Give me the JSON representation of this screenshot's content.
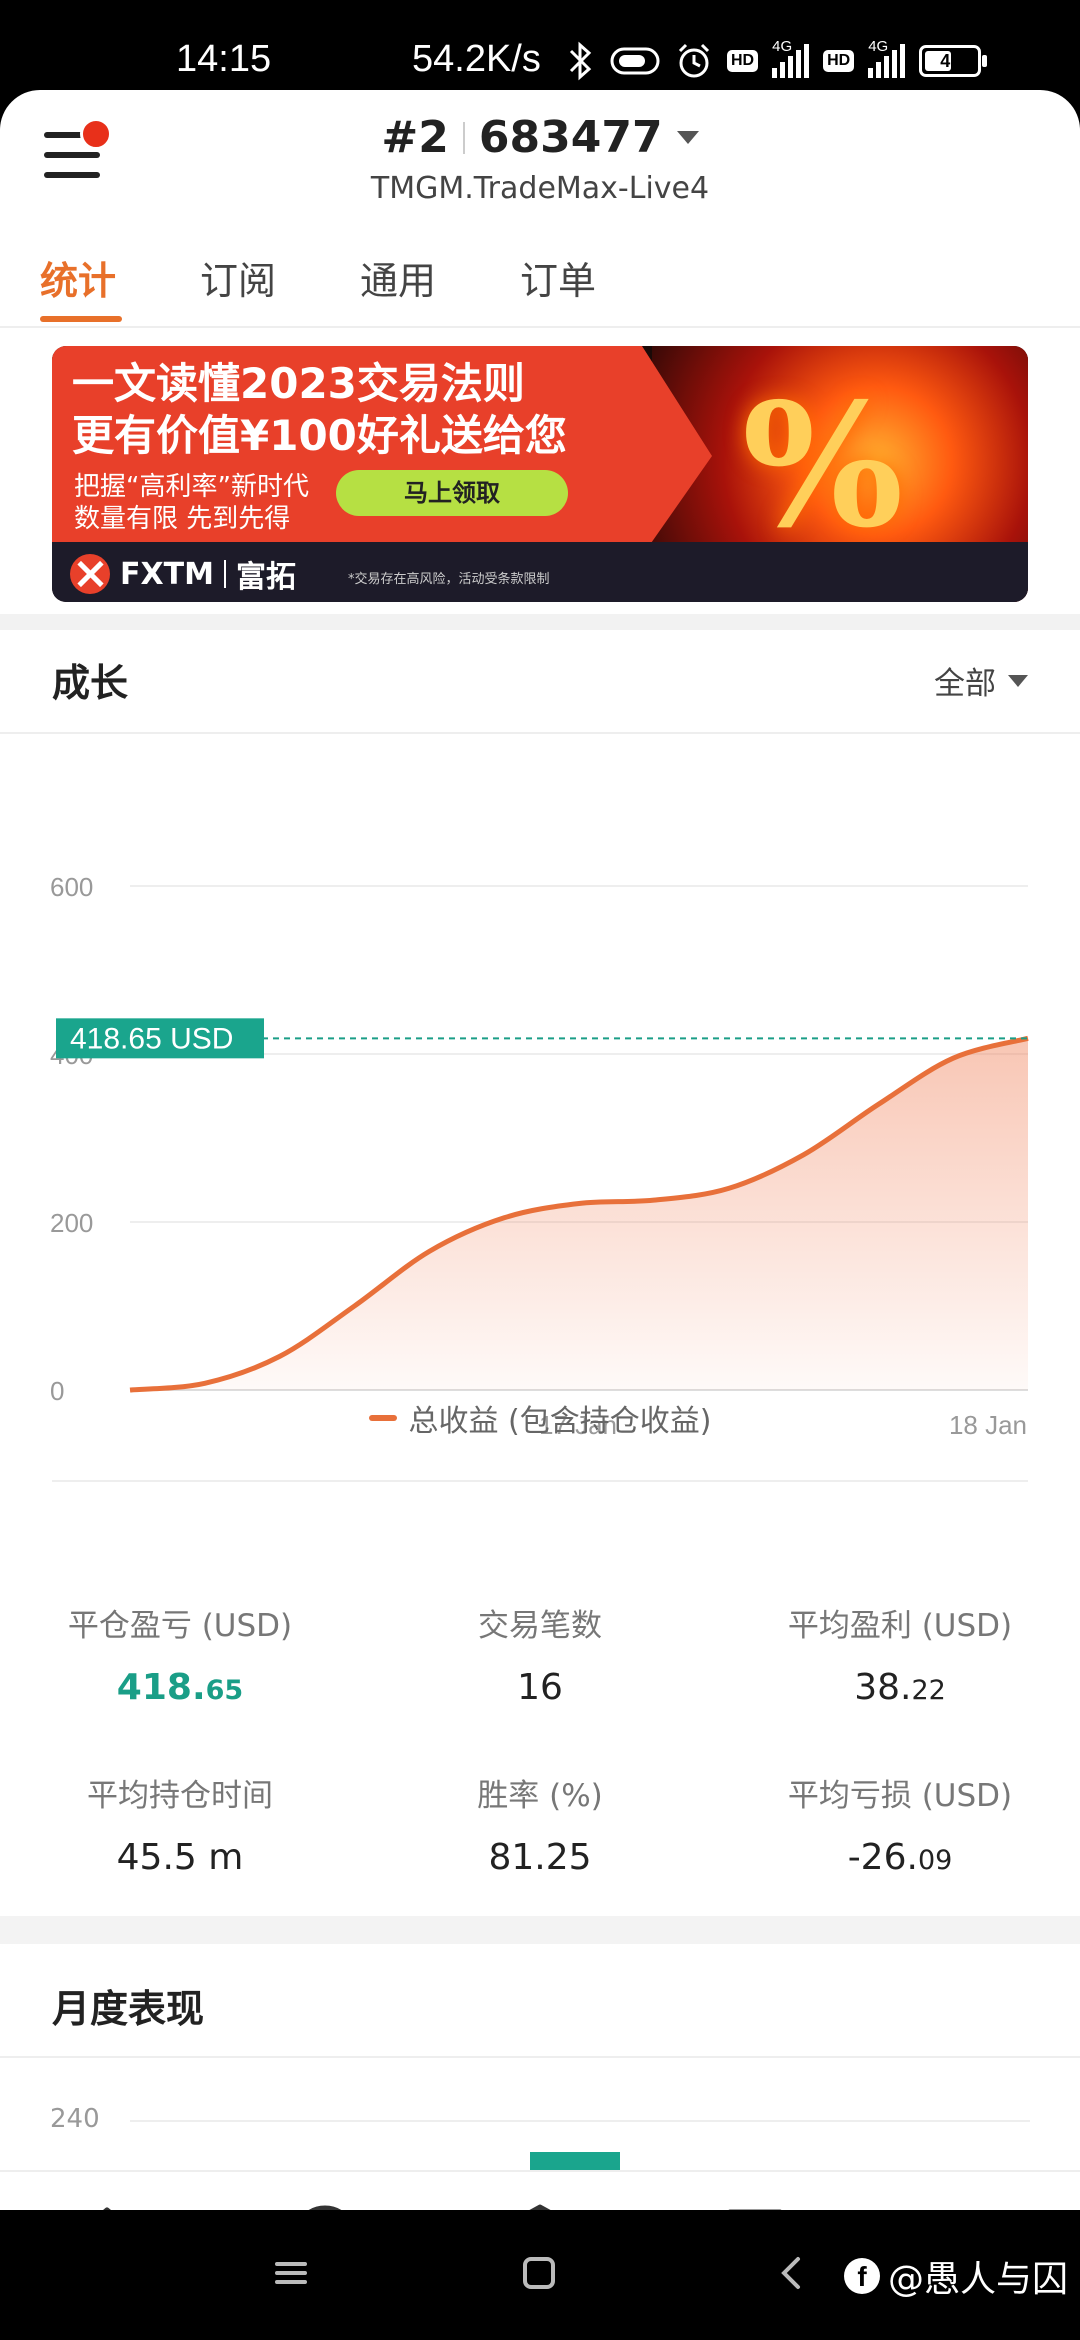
{
  "status_bar": {
    "time": "14:15",
    "net_speed": "54.2K/s",
    "hd_label": "HD",
    "network_label": "4G",
    "battery": "47"
  },
  "header": {
    "account_number": "#2",
    "account_id": "683477",
    "server": "TMGM.TradeMax-Live4"
  },
  "tabs": [
    {
      "label": "统计",
      "active": true
    },
    {
      "label": "订阅",
      "active": false
    },
    {
      "label": "通用",
      "active": false
    },
    {
      "label": "订单",
      "active": false
    }
  ],
  "banner": {
    "headline1": "一文读懂2023交易法则",
    "headline2": "更有价值¥100好礼送给您",
    "sub1": "把握“高利率”新时代",
    "sub2": "数量有限 先到先得",
    "cta": "马上领取",
    "brand": "FXTM",
    "brand_cn": "富拓",
    "disclaimer": "*交易存在高风险，活动受条款限制",
    "graphic_text": "%"
  },
  "growth": {
    "title": "成长",
    "filter": "全部"
  },
  "chart_data": {
    "type": "area",
    "y_ticks": [
      "600",
      "400",
      "200",
      "0"
    ],
    "x_ticks": [
      "17 Jan",
      "18 Jan"
    ],
    "ylim": [
      0,
      600
    ],
    "current_value_label": "418.65 USD",
    "current_value": 418.65,
    "series": [
      {
        "name": "总收益 (包含持仓收益)",
        "color": "#e8703a",
        "values": [
          0,
          8,
          40,
          100,
          165,
          205,
          222,
          226,
          240,
          280,
          340,
          395,
          418.65
        ]
      }
    ]
  },
  "stats": [
    {
      "label": "平仓盈亏 (USD)",
      "value": "418.",
      "decimals": "65",
      "green": true
    },
    {
      "label": "交易笔数",
      "value": "16",
      "decimals": "",
      "green": false
    },
    {
      "label": "平均盈利 (USD)",
      "value": "38.",
      "decimals": "22",
      "green": false
    },
    {
      "label": "平均持仓时间",
      "value": "45.5 m",
      "decimals": "",
      "green": false
    },
    {
      "label": "胜率 (%)",
      "value": "81.25",
      "decimals": "",
      "green": false
    },
    {
      "label": "平均亏损 (USD)",
      "value": "-26.",
      "decimals": "09",
      "green": false
    }
  ],
  "monthly": {
    "title": "月度表现",
    "y_tick": "240"
  },
  "bottom_nav": [
    {
      "icon": "home-icon"
    },
    {
      "icon": "signal-icon"
    },
    {
      "icon": "trade-icon"
    },
    {
      "icon": "message-icon"
    },
    {
      "icon": "account-card-icon",
      "active": true
    }
  ],
  "watermark": "@愚人与囚"
}
